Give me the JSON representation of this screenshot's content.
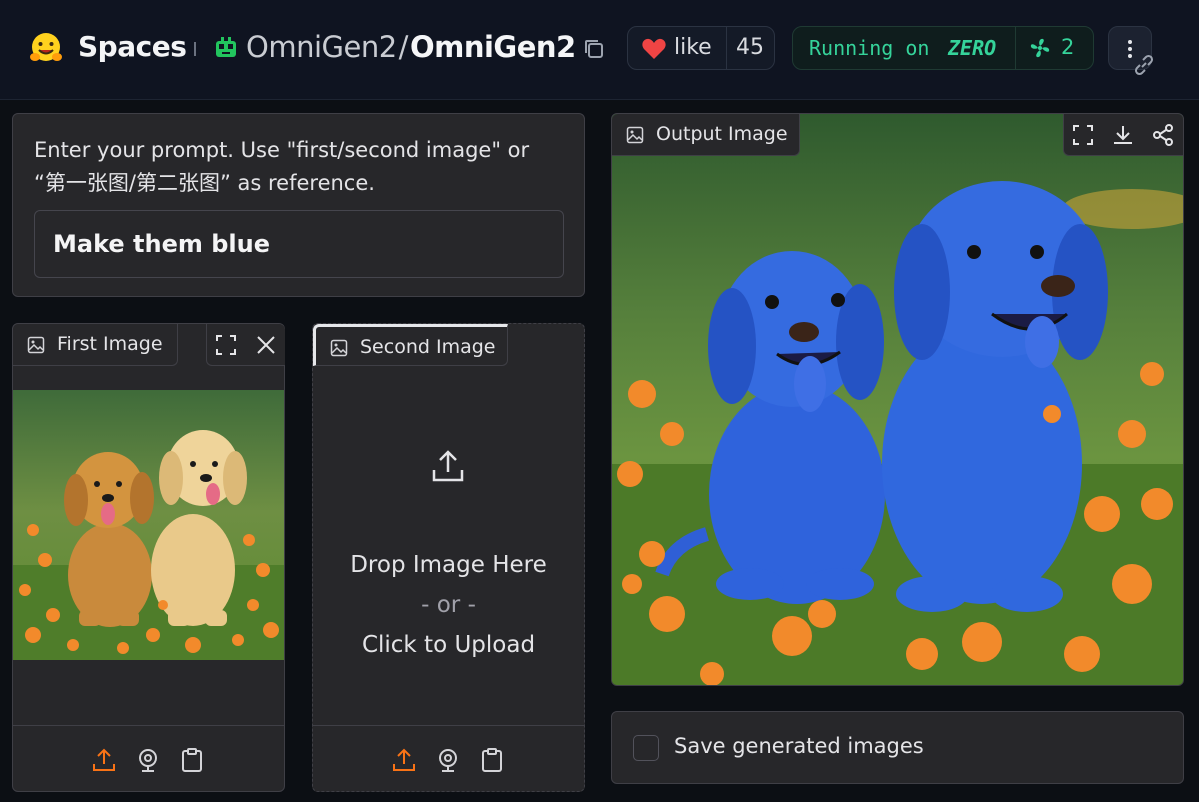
{
  "header": {
    "spaces_label": "Spaces",
    "org": "OmniGen2",
    "repo": "OmniGen2",
    "like_label": "like",
    "like_count": "45",
    "running_label": "Running on",
    "hardware": "ZERO",
    "replicas": "2"
  },
  "prompt": {
    "label": "Enter your prompt. Use \"first/second image\" or “第一张图/第二张图” as reference.",
    "value": "Make them blue"
  },
  "first_image": {
    "label": "First Image"
  },
  "second_image": {
    "label": "Second Image",
    "drop_text": "Drop Image Here",
    "or_text": "- or -",
    "click_text": "Click to Upload"
  },
  "output_image": {
    "label": "Output Image"
  },
  "save": {
    "label": "Save generated images",
    "checked": false
  },
  "colors": {
    "accent_orange": "#f97316",
    "running_green": "#35d39a",
    "panel_bg": "#27272a",
    "heart_red": "#ef4444"
  },
  "icons": {
    "upload": "upload-icon",
    "webcam": "webcam-icon",
    "clipboard": "clipboard-icon",
    "fullscreen": "fullscreen-icon",
    "download": "download-icon",
    "share": "share-icon",
    "close": "close-icon"
  }
}
